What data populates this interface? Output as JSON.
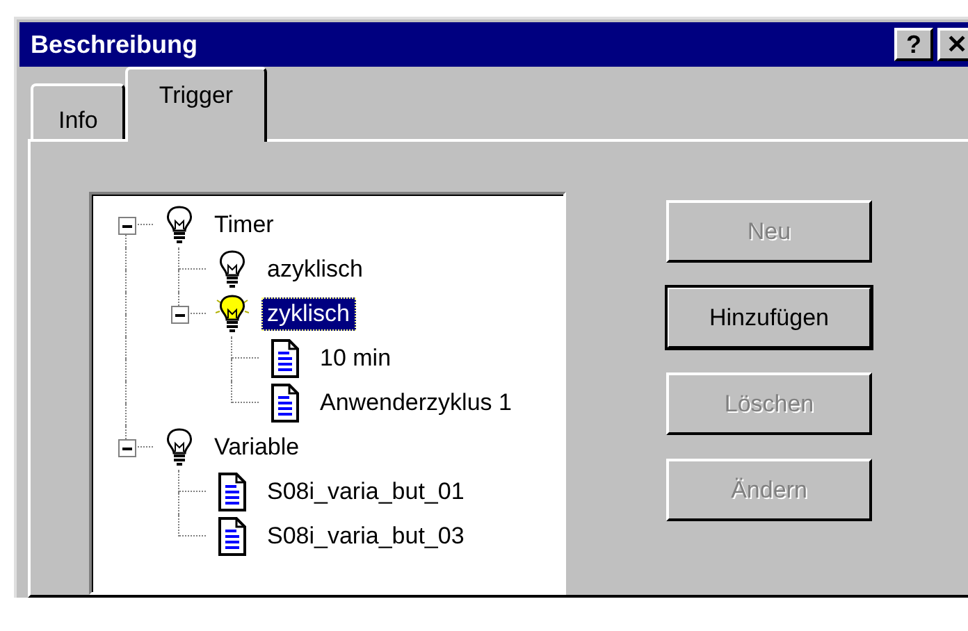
{
  "window": {
    "title": "Beschreibung",
    "title_buttons": [
      "?",
      "✕"
    ]
  },
  "tabs": [
    {
      "label": "Info",
      "selected": false
    },
    {
      "label": "Trigger",
      "selected": true
    }
  ],
  "tree": [
    {
      "label": "Timer",
      "kind": "bulb",
      "expanded": true,
      "selected": false,
      "children": [
        {
          "label": "azyklisch",
          "kind": "bulb",
          "selected": false
        },
        {
          "label": "zyklisch",
          "kind": "bulb-lit",
          "expanded": true,
          "selected": true,
          "children": [
            {
              "label": "10 min",
              "kind": "doc",
              "selected": false
            },
            {
              "label": "Anwenderzyklus 1",
              "kind": "doc",
              "selected": false
            }
          ]
        }
      ]
    },
    {
      "label": "Variable",
      "kind": "bulb",
      "expanded": true,
      "selected": false,
      "children": [
        {
          "label": "S08i_varia_but_01",
          "kind": "doc",
          "selected": false
        },
        {
          "label": "S08i_varia_but_03",
          "kind": "doc",
          "selected": false
        }
      ]
    }
  ],
  "buttons": [
    {
      "label": "Neu",
      "disabled": true,
      "default": false
    },
    {
      "label": "Hinzufügen",
      "disabled": false,
      "default": true
    },
    {
      "label": "Löschen",
      "disabled": true,
      "default": false
    },
    {
      "label": "Ändern",
      "disabled": true,
      "default": false
    }
  ]
}
